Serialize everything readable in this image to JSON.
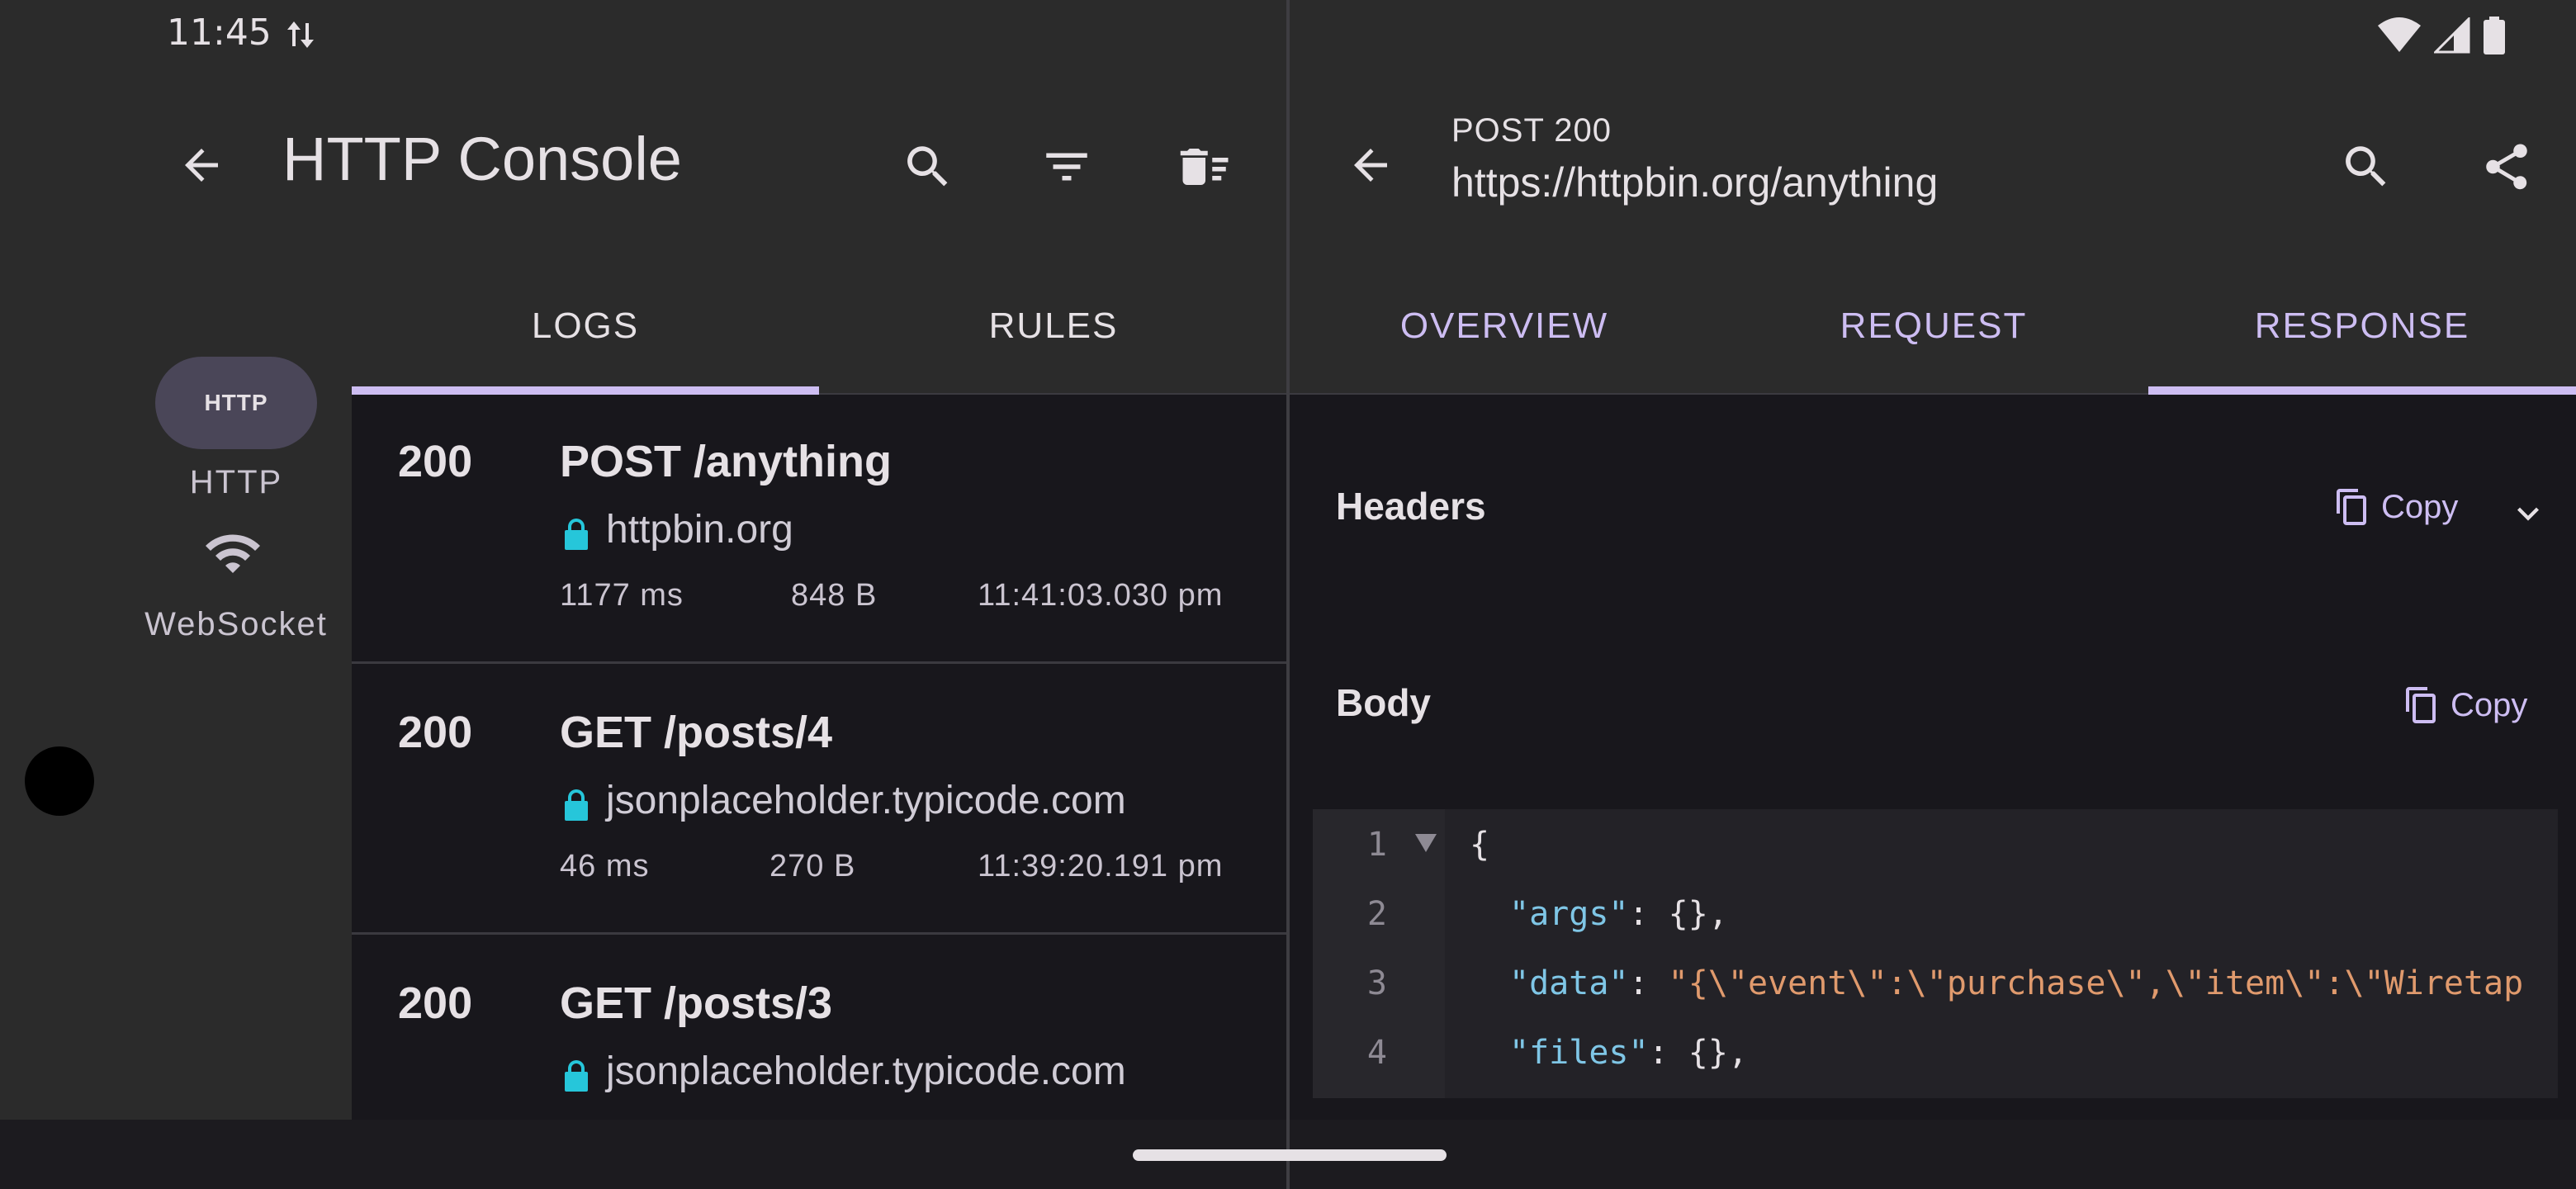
{
  "status_bar": {
    "time": "11:45",
    "icons": [
      "data-transfer-icon",
      "wifi-icon",
      "signal-icon",
      "battery-icon"
    ]
  },
  "left": {
    "title": "HTTP Console",
    "actions": [
      "back-icon",
      "search-icon",
      "filter-icon",
      "delete-sweep-icon"
    ],
    "rail": {
      "http_badge": "HTTP",
      "http_label": "HTTP",
      "ws_label": "WebSocket"
    },
    "tabs": {
      "logs": "LOGS",
      "rules": "RULES"
    },
    "logs": [
      {
        "code": "200",
        "path": "POST /anything",
        "host": "httpbin.org",
        "duration": "1177 ms",
        "size": "848 B",
        "time": "11:41:03.030 pm"
      },
      {
        "code": "200",
        "path": "GET /posts/4",
        "host": "jsonplaceholder.typicode.com",
        "duration": "46 ms",
        "size": "270 B",
        "time": "11:39:20.191 pm"
      },
      {
        "code": "200",
        "path": "GET /posts/3",
        "host": "jsonplaceholder.typicode.com",
        "duration": "",
        "size": "",
        "time": ""
      }
    ]
  },
  "right": {
    "status_line": "POST 200",
    "url": "https://httpbin.org/anything",
    "tabs": {
      "overview": "OVERVIEW",
      "request": "REQUEST",
      "response": "RESPONSE"
    },
    "headers_title": "Headers",
    "body_title": "Body",
    "copy_label": "Copy",
    "code": {
      "line_numbers": [
        "1",
        "2",
        "3",
        "4"
      ],
      "line1": "{",
      "line2_key": "\"args\"",
      "line2_rest": ": {},",
      "line3_key": "\"data\"",
      "line3_colon": ": ",
      "line3_val": "\"{\\\"event\\\":\\\"purchase\\\",\\\"item\\\":\\\"Wiretap",
      "line4_key": "\"files\"",
      "line4_rest": ": {},"
    }
  },
  "colors": {
    "accent": "#cdbdf2",
    "lock": "#26c6da",
    "json_key": "#7fc6e6",
    "json_string": "#e09a6d"
  }
}
